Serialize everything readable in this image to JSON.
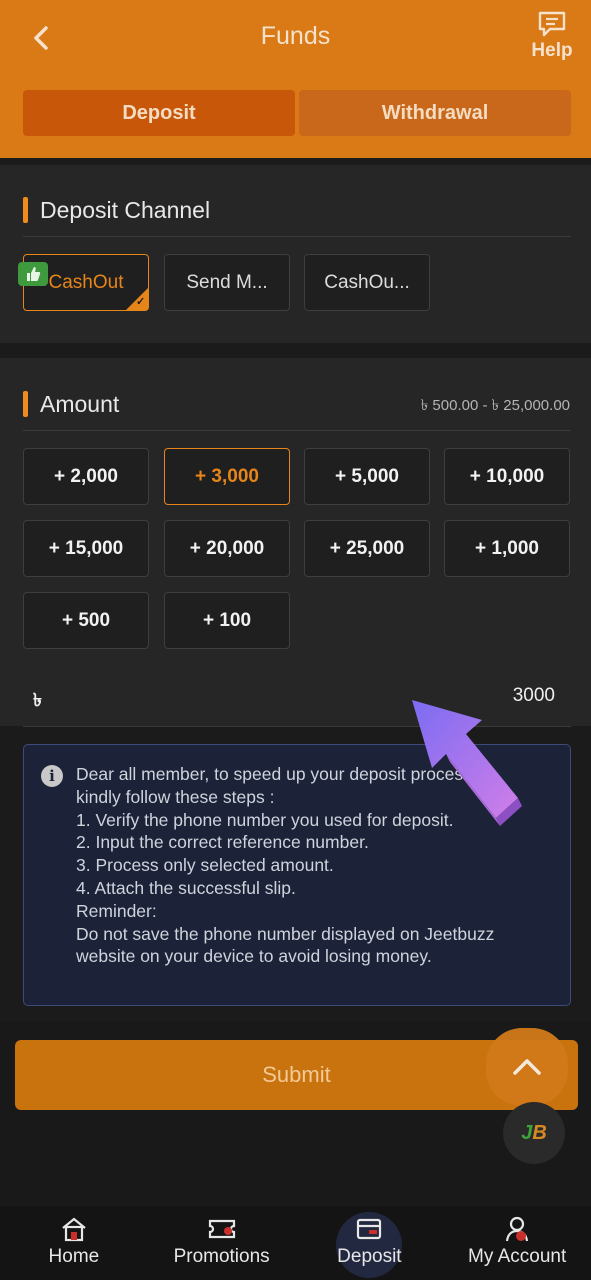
{
  "header": {
    "title": "Funds",
    "help_label": "Help",
    "tabs": [
      {
        "label": "Deposit",
        "active": true
      },
      {
        "label": "Withdrawal",
        "active": false
      }
    ]
  },
  "deposit_channel": {
    "title": "Deposit Channel",
    "channels": [
      {
        "label": "CashOut",
        "selected": true
      },
      {
        "label": "Send M..."
      },
      {
        "label": "CashOu..."
      }
    ]
  },
  "amount": {
    "title": "Amount",
    "range": "৳ 500.00 - ৳ 25,000.00",
    "options": [
      "+ 2,000",
      "+ 3,000",
      "+ 5,000",
      "+ 10,000",
      "+ 15,000",
      "+ 20,000",
      "+ 25,000",
      "+ 1,000",
      "+ 500",
      "+ 100"
    ],
    "selected_index": 1,
    "currency_symbol": "৳",
    "value": "3000"
  },
  "notice": {
    "lines": [
      "Dear all member, to speed up your deposit process,",
      "kindly follow these steps :",
      "1. Verify the phone number you used for deposit.",
      "2. Input the correct reference number.",
      "3. Process only selected amount.",
      "4. Attach the successful slip.",
      "Reminder:",
      "Do not save the phone number displayed on Jeetbuzz",
      "website on your device to avoid losing money."
    ]
  },
  "submit_label": "Submit",
  "logo_text": {
    "left": "J",
    "right": "B"
  },
  "nav": [
    {
      "label": "Home",
      "icon": "home-icon"
    },
    {
      "label": "Promotions",
      "icon": "ticket-icon"
    },
    {
      "label": "Deposit",
      "icon": "wallet-icon",
      "active": true
    },
    {
      "label": "My Account",
      "icon": "account-icon"
    }
  ],
  "colors": {
    "brand_orange": "#d97a16",
    "accent": "#e6851a",
    "notice_bg": "#1c2237"
  }
}
